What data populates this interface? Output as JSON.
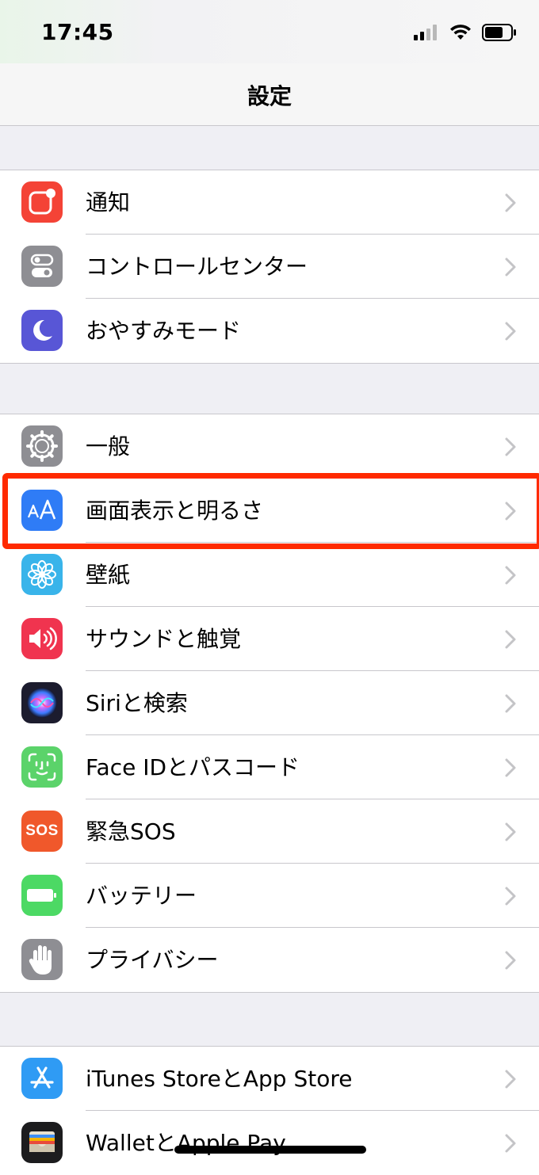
{
  "status_bar": {
    "time": "17:45",
    "icons": [
      "cellular-signal-icon",
      "wifi-icon",
      "battery-icon"
    ]
  },
  "nav": {
    "title": "設定"
  },
  "groups": [
    {
      "items": [
        {
          "label": "通知",
          "icon": "notifications-icon",
          "color": "#f44336"
        },
        {
          "label": "コントロールセンター",
          "icon": "control-center-icon",
          "color": "#8e8e93"
        },
        {
          "label": "おやすみモード",
          "icon": "moon-icon",
          "color": "#5856d6"
        }
      ]
    },
    {
      "items": [
        {
          "label": "一般",
          "icon": "gear-icon",
          "color": "#8e8e93"
        },
        {
          "label": "画面表示と明るさ",
          "icon": "text-size-icon",
          "color": "#2f7cf6",
          "highlighted": true
        },
        {
          "label": "壁紙",
          "icon": "flower-icon",
          "color": "#39b4ea"
        },
        {
          "label": "サウンドと触覚",
          "icon": "speaker-icon",
          "color": "#f0344f"
        },
        {
          "label": "Siriと検索",
          "icon": "siri-icon",
          "color": "#1c1c2e"
        },
        {
          "label": "Face IDとパスコード",
          "icon": "face-id-icon",
          "color": "#5bd36a"
        },
        {
          "label": "緊急SOS",
          "icon": "sos-icon",
          "color": "#f0582b",
          "icon_text": "SOS"
        },
        {
          "label": "バッテリー",
          "icon": "battery-setting-icon",
          "color": "#4cd964"
        },
        {
          "label": "プライバシー",
          "icon": "hand-icon",
          "color": "#8e8e93"
        }
      ]
    },
    {
      "items": [
        {
          "label": "iTunes StoreとApp Store",
          "icon": "app-store-icon",
          "color": "#2f9bf4"
        },
        {
          "label": "WalletとApple Pay",
          "icon": "wallet-icon",
          "color": "#1c1c1e"
        }
      ]
    }
  ],
  "colors": {
    "highlight": "#ff2a00",
    "chevron": "#c4c4c7",
    "background": "#efeff4"
  }
}
